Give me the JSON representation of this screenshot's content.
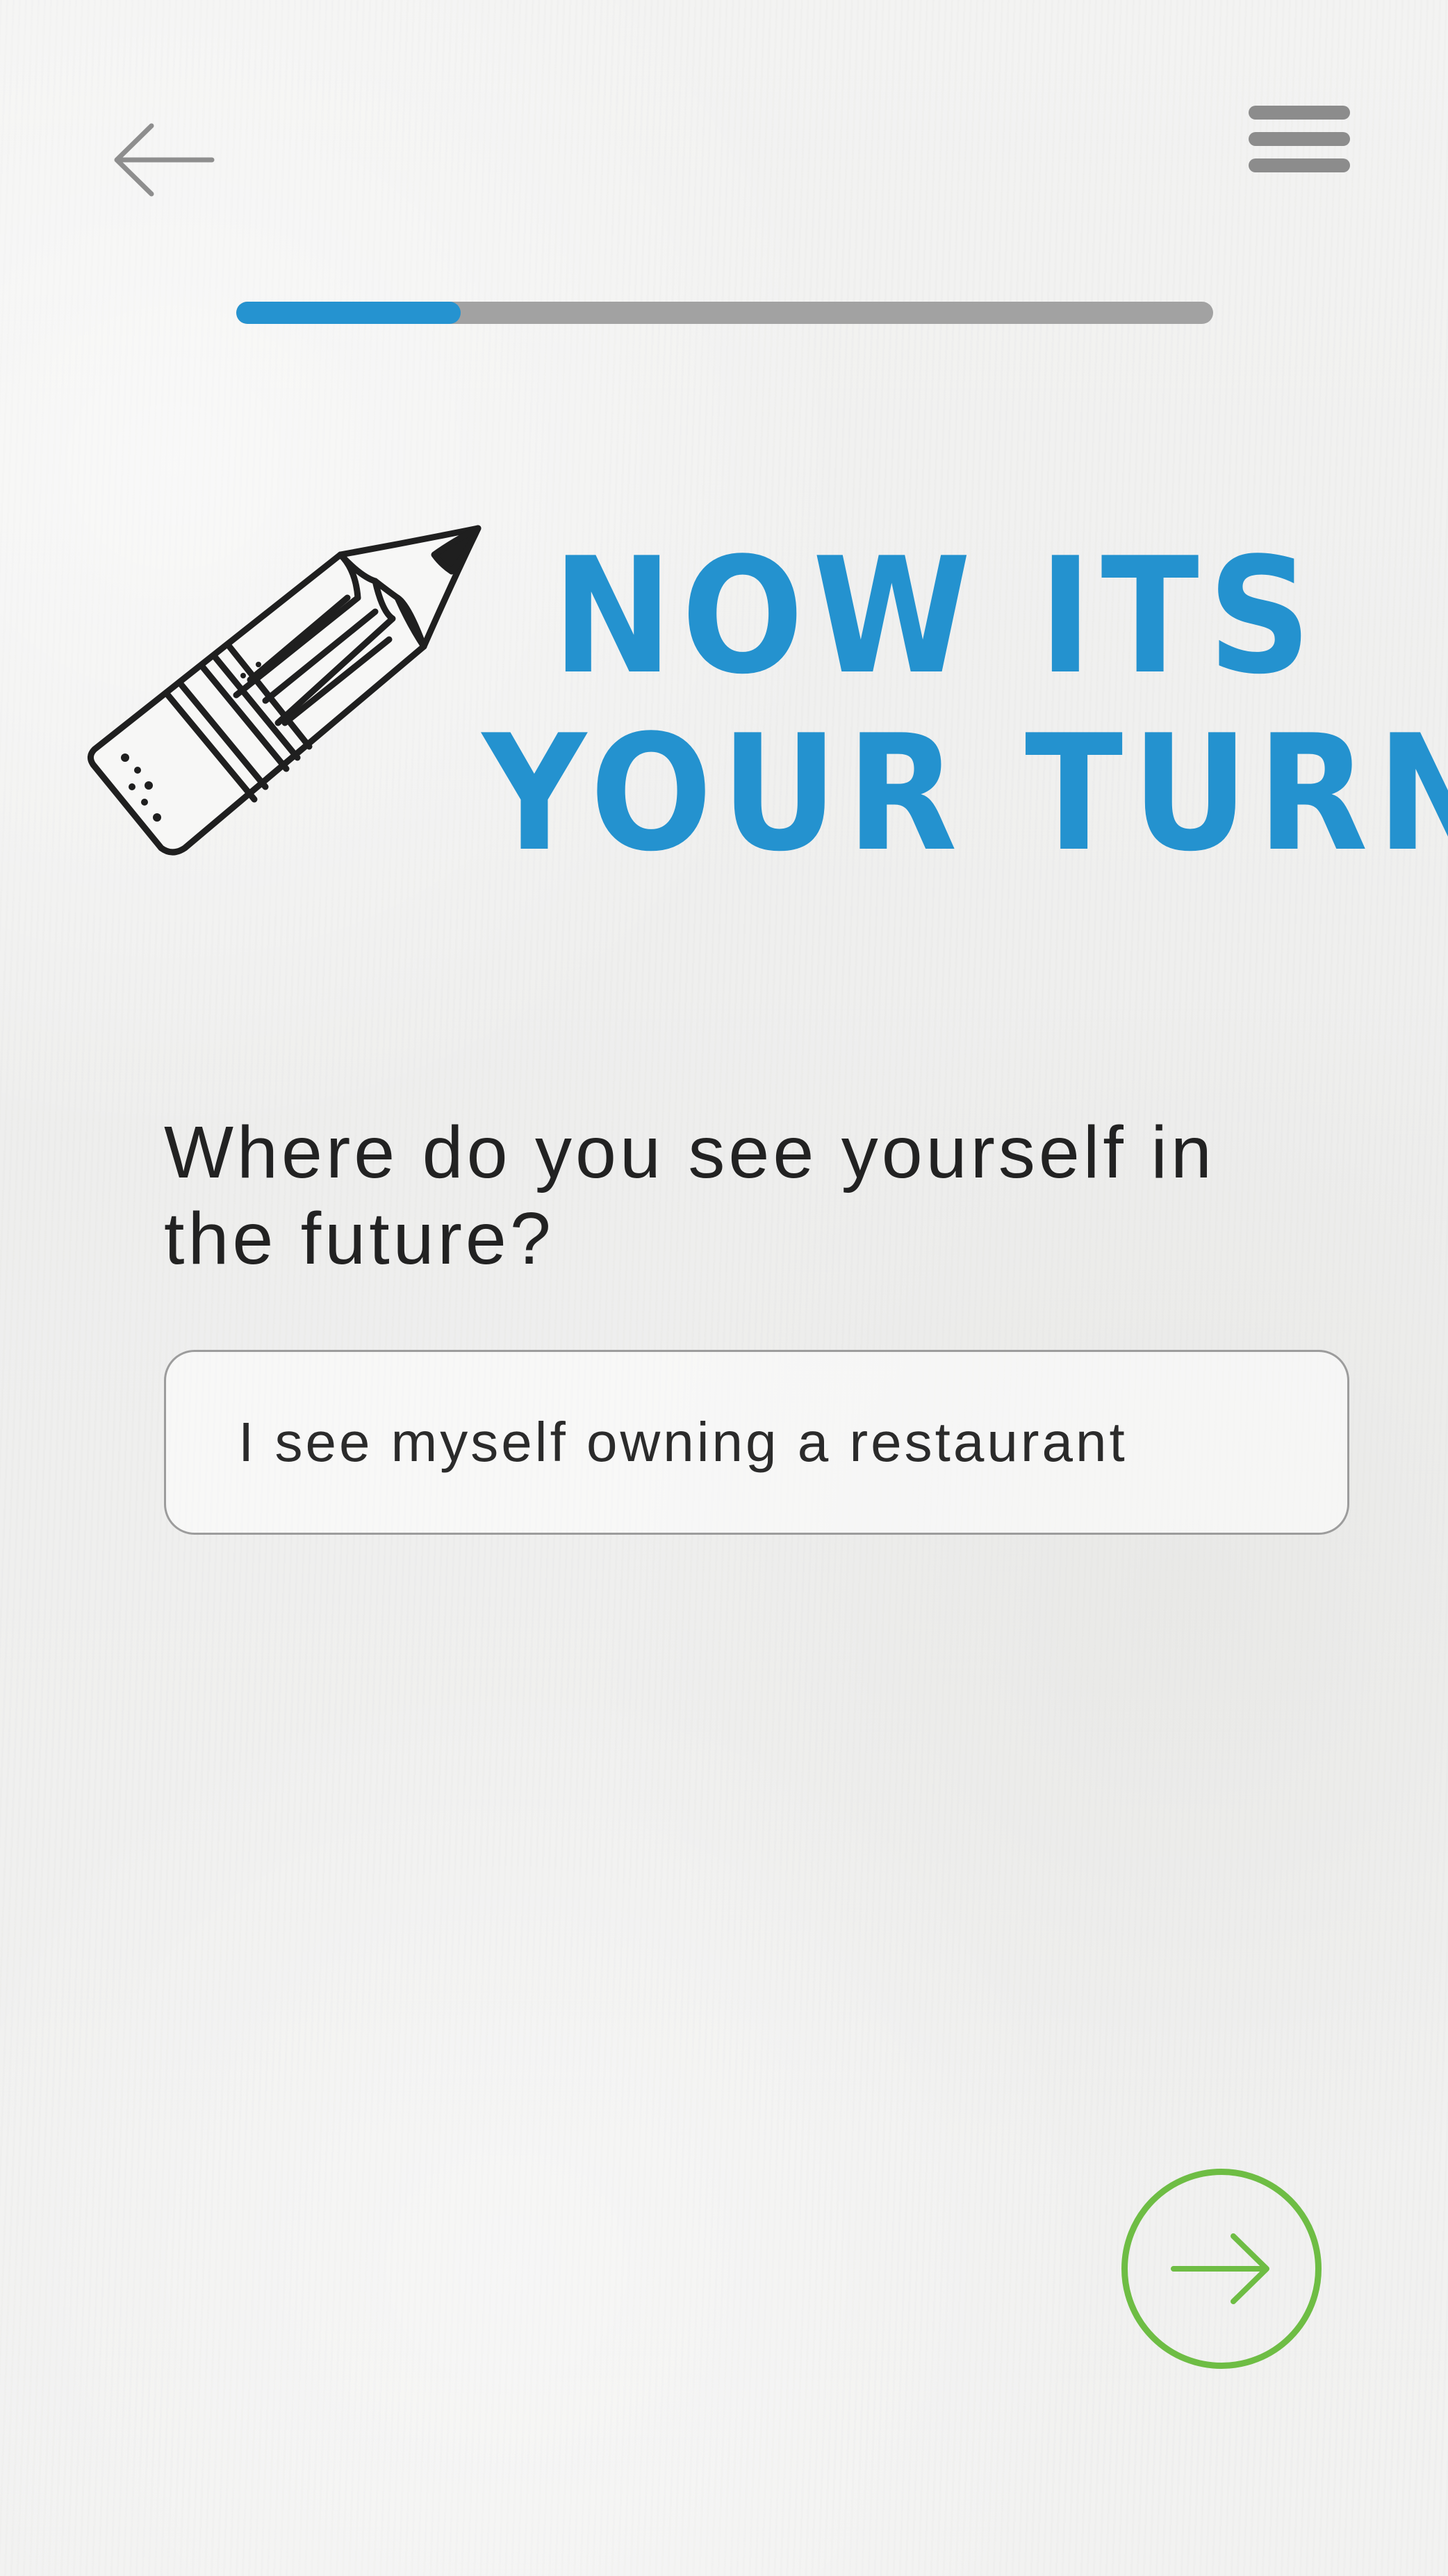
{
  "header": {
    "back_icon": "arrow-left-icon",
    "menu_icon": "hamburger-menu-icon"
  },
  "progress": {
    "value": 0.23,
    "fill_color": "#2593d0",
    "track_color": "#a2a2a2"
  },
  "hero": {
    "illustration": "pencil-icon",
    "title_line1": "NOW ITS",
    "title_line2": "YOUR TURN",
    "title_color": "#2492cf"
  },
  "question": {
    "text": "Where do you see yourself in the future?"
  },
  "answer": {
    "value": "I see myself owning a restaurant"
  },
  "footer": {
    "next_icon": "arrow-right-icon",
    "accent_color": "#6ebd44"
  }
}
